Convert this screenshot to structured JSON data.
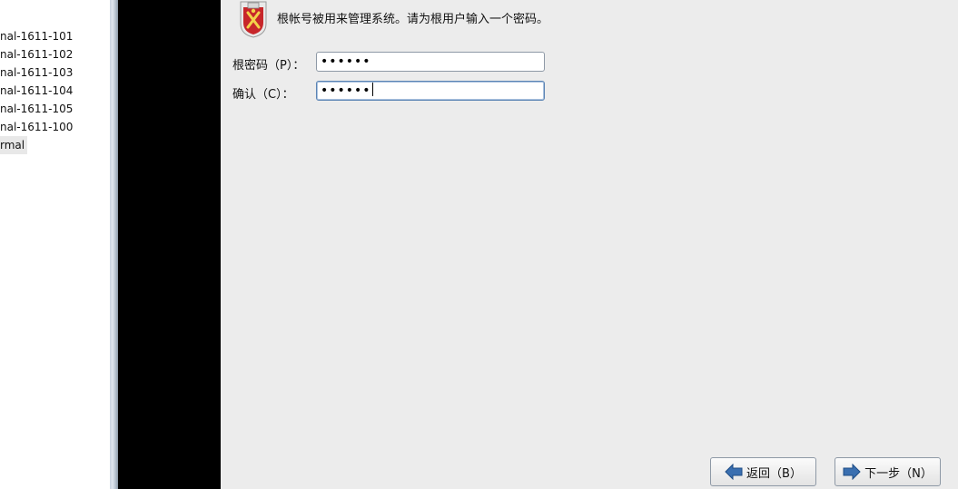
{
  "sidebar": {
    "items": [
      {
        "label": "nal-1611-101"
      },
      {
        "label": "nal-1611-102"
      },
      {
        "label": "nal-1611-103"
      },
      {
        "label": "nal-1611-104"
      },
      {
        "label": "nal-1611-105"
      },
      {
        "label": "nal-1611-100"
      },
      {
        "label": "rmal"
      }
    ]
  },
  "installer": {
    "header_icon": "root-shield-icon",
    "header_text": "根帐号被用来管理系统。请为根用户输入一个密码。",
    "password_label": "根密码（P）：",
    "password_value": "••••••",
    "confirm_label": "确认（C）：",
    "confirm_value": "••••••",
    "back_label": "返回（B）",
    "next_label": "下一步（N）"
  },
  "colors": {
    "installer_bg": "#ececec",
    "console_bg": "#000000",
    "arrow_blue": "#3a6fb0"
  }
}
